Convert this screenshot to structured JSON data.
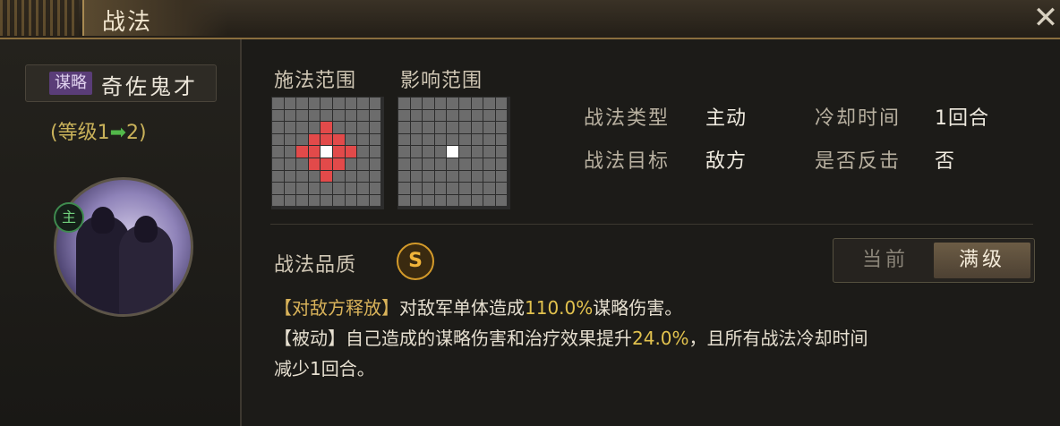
{
  "window": {
    "title": "战法"
  },
  "skill": {
    "category": "谋略",
    "name": "奇佐鬼才",
    "level_prefix": "(等级1",
    "level_arrow": "➡",
    "level_suffix": "2)",
    "leader_badge": "主"
  },
  "ranges": {
    "cast_label": "施法范围",
    "effect_label": "影响范围",
    "cast_grid": [
      "000000000",
      "000000000",
      "000020000",
      "000222000",
      "002212200",
      "000222000",
      "000020000",
      "000000000",
      "000000000"
    ],
    "effect_grid": [
      "000000000",
      "000000000",
      "000000000",
      "000000000",
      "000010000",
      "000000000",
      "000000000",
      "000000000",
      "000000000"
    ]
  },
  "stats": {
    "type_label": "战法类型",
    "type_value": "主动",
    "cooldown_label": "冷却时间",
    "cooldown_value": "1回合",
    "target_label": "战法目标",
    "target_value": "敌方",
    "counter_label": "是否反击",
    "counter_value": "否"
  },
  "quality": {
    "label": "战法品质",
    "grade": "S"
  },
  "toggle": {
    "current_label": "当前",
    "max_label": "满级",
    "selected": "满级"
  },
  "description": {
    "line1_tag": "【对敌方释放】",
    "line1_text_a": "对敌军单体造成",
    "line1_value": "110.0%",
    "line1_text_b": "谋略伤害。",
    "line2_tag": "【被动】",
    "line2_text_a": "自己造成的谋略伤害和治疗效果提升",
    "line2_value": "24.0%",
    "line2_text_b": "，且所有战法冷却时间",
    "line3_text": "减少1回合。"
  },
  "colors": {
    "accent_gold": "#d9b35a",
    "value_yellow": "#e2c24e",
    "range_red": "#e24a4a",
    "grid_gray": "#6c6c6c"
  }
}
